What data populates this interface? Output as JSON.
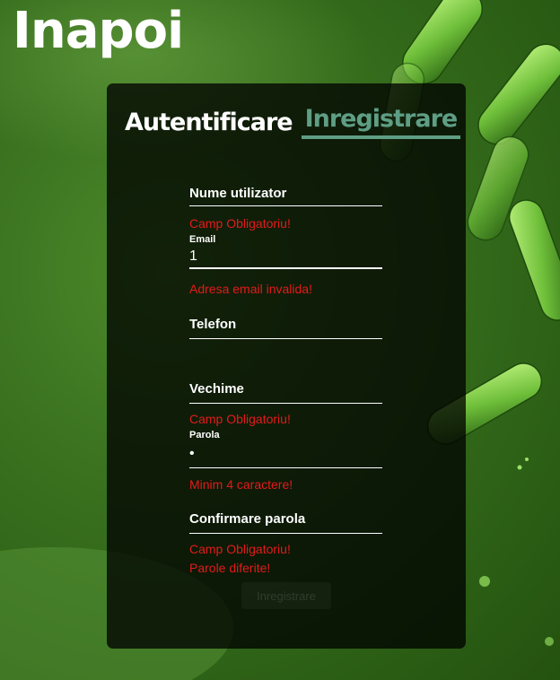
{
  "header": {
    "back_label": "Inapoi"
  },
  "tabs": {
    "login": "Autentificare",
    "register": "Inregistrare"
  },
  "form": {
    "username": {
      "label": "Nume utilizator",
      "value": "",
      "error": "Camp Obligatoriu!"
    },
    "email": {
      "label": "Email",
      "value": "1",
      "error": "Adresa email invalida!"
    },
    "phone": {
      "label": "Telefon",
      "value": ""
    },
    "seniority": {
      "label": "Vechime",
      "value": "",
      "error": "Camp Obligatoriu!"
    },
    "password": {
      "label": "Parola",
      "value": "•",
      "error": "Minim 4 caractere!"
    },
    "confirm_password": {
      "label": "Confirmare parola",
      "value": "",
      "error_required": "Camp Obligatoriu!",
      "error_mismatch": "Parole diferite!"
    },
    "submit_label": "Inregistrare"
  },
  "colors": {
    "accent": "#5e9e85",
    "error": "#e31b1b",
    "background": "#3b7320"
  }
}
